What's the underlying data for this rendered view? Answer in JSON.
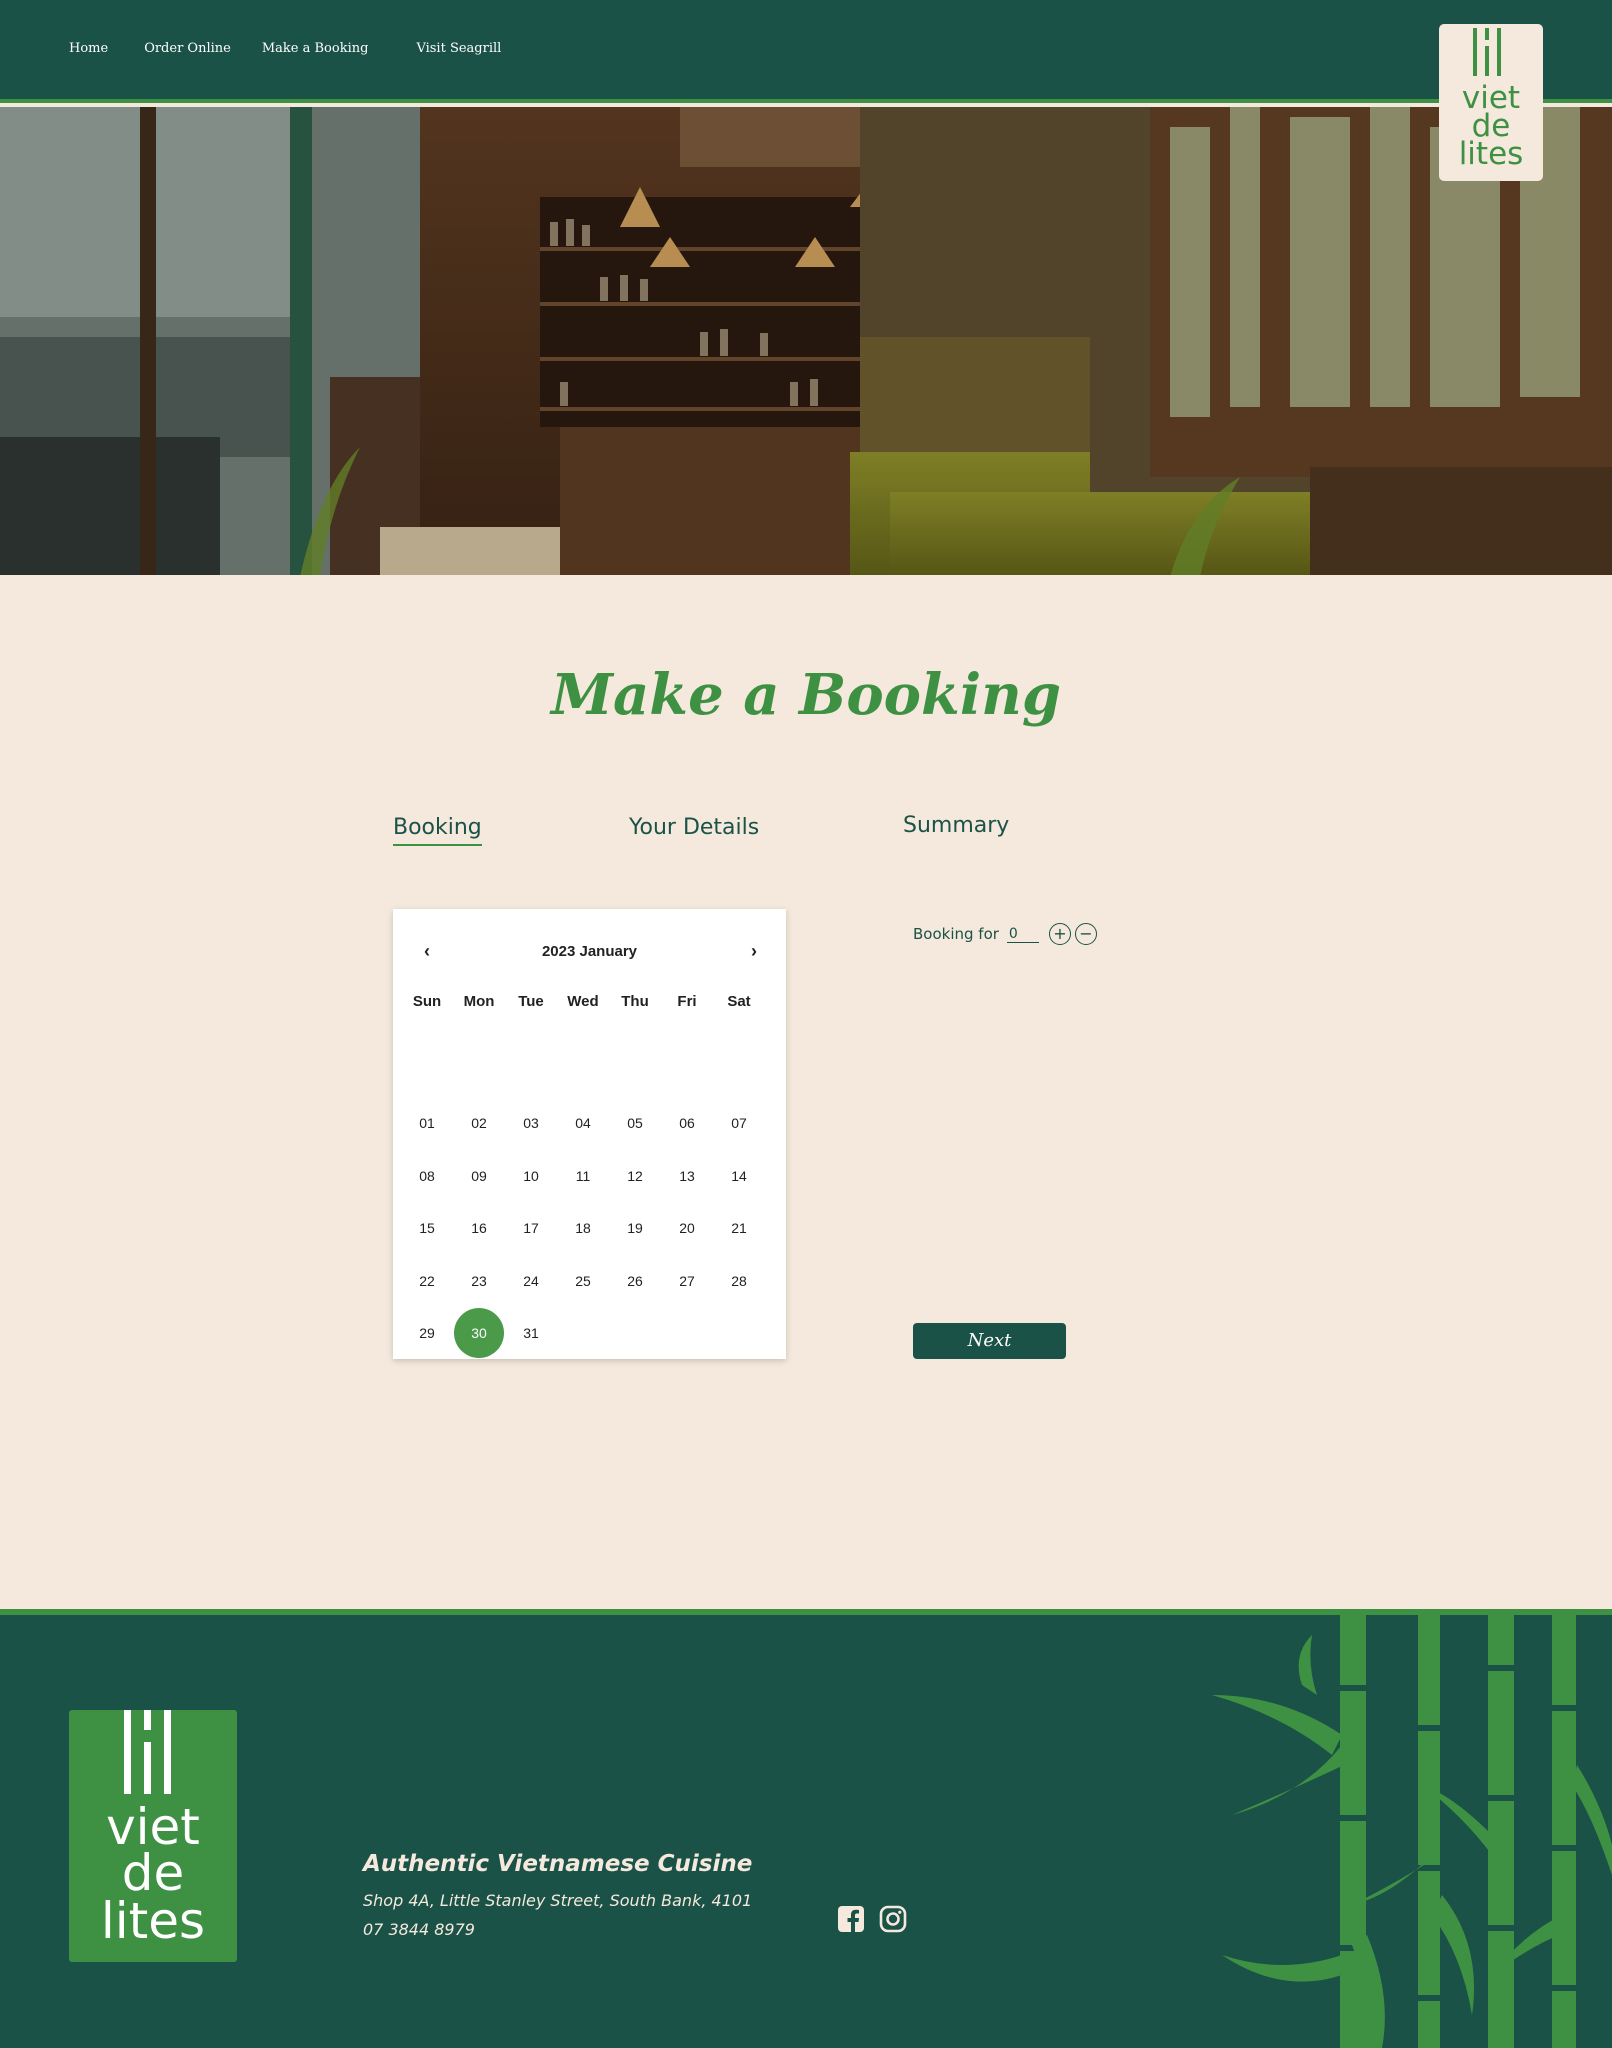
{
  "nav": {
    "items": [
      "Home",
      "Order Online",
      "Make a Booking",
      "Visit Seagrill"
    ]
  },
  "brand": {
    "logo_lines": [
      "viet",
      "de",
      "lites"
    ],
    "colors": {
      "dark_green": "#1b5248",
      "accent_green": "#3e9143",
      "cream": "#f4e9dc"
    }
  },
  "page": {
    "title": "Make a Booking"
  },
  "tabs": {
    "booking": "Booking",
    "details": "Your Details",
    "summary": "Summary"
  },
  "calendar": {
    "prev": "‹",
    "next": "›",
    "title": "2023 January",
    "weekdays": [
      "Sun",
      "Mon",
      "Tue",
      "Wed",
      "Thu",
      "Fri",
      "Sat"
    ],
    "weeks": [
      [
        "01",
        "02",
        "03",
        "04",
        "05",
        "06",
        "07"
      ],
      [
        "08",
        "09",
        "10",
        "11",
        "12",
        "13",
        "14"
      ],
      [
        "15",
        "16",
        "17",
        "18",
        "19",
        "20",
        "21"
      ],
      [
        "22",
        "23",
        "24",
        "25",
        "26",
        "27",
        "28"
      ],
      [
        "29",
        "30",
        "31",
        "",
        "",
        "",
        ""
      ]
    ],
    "selected": "30"
  },
  "booking_for": {
    "label": "Booking for",
    "value": "0",
    "plus": "+",
    "minus": "−"
  },
  "next_button": "Next",
  "footer": {
    "tagline": "Authentic Vietnamese Cuisine",
    "address": "Shop 4A, Little Stanley Street, South Bank, 4101",
    "phone": "07 3844 8979",
    "social": [
      "facebook-icon",
      "instagram-icon"
    ]
  }
}
